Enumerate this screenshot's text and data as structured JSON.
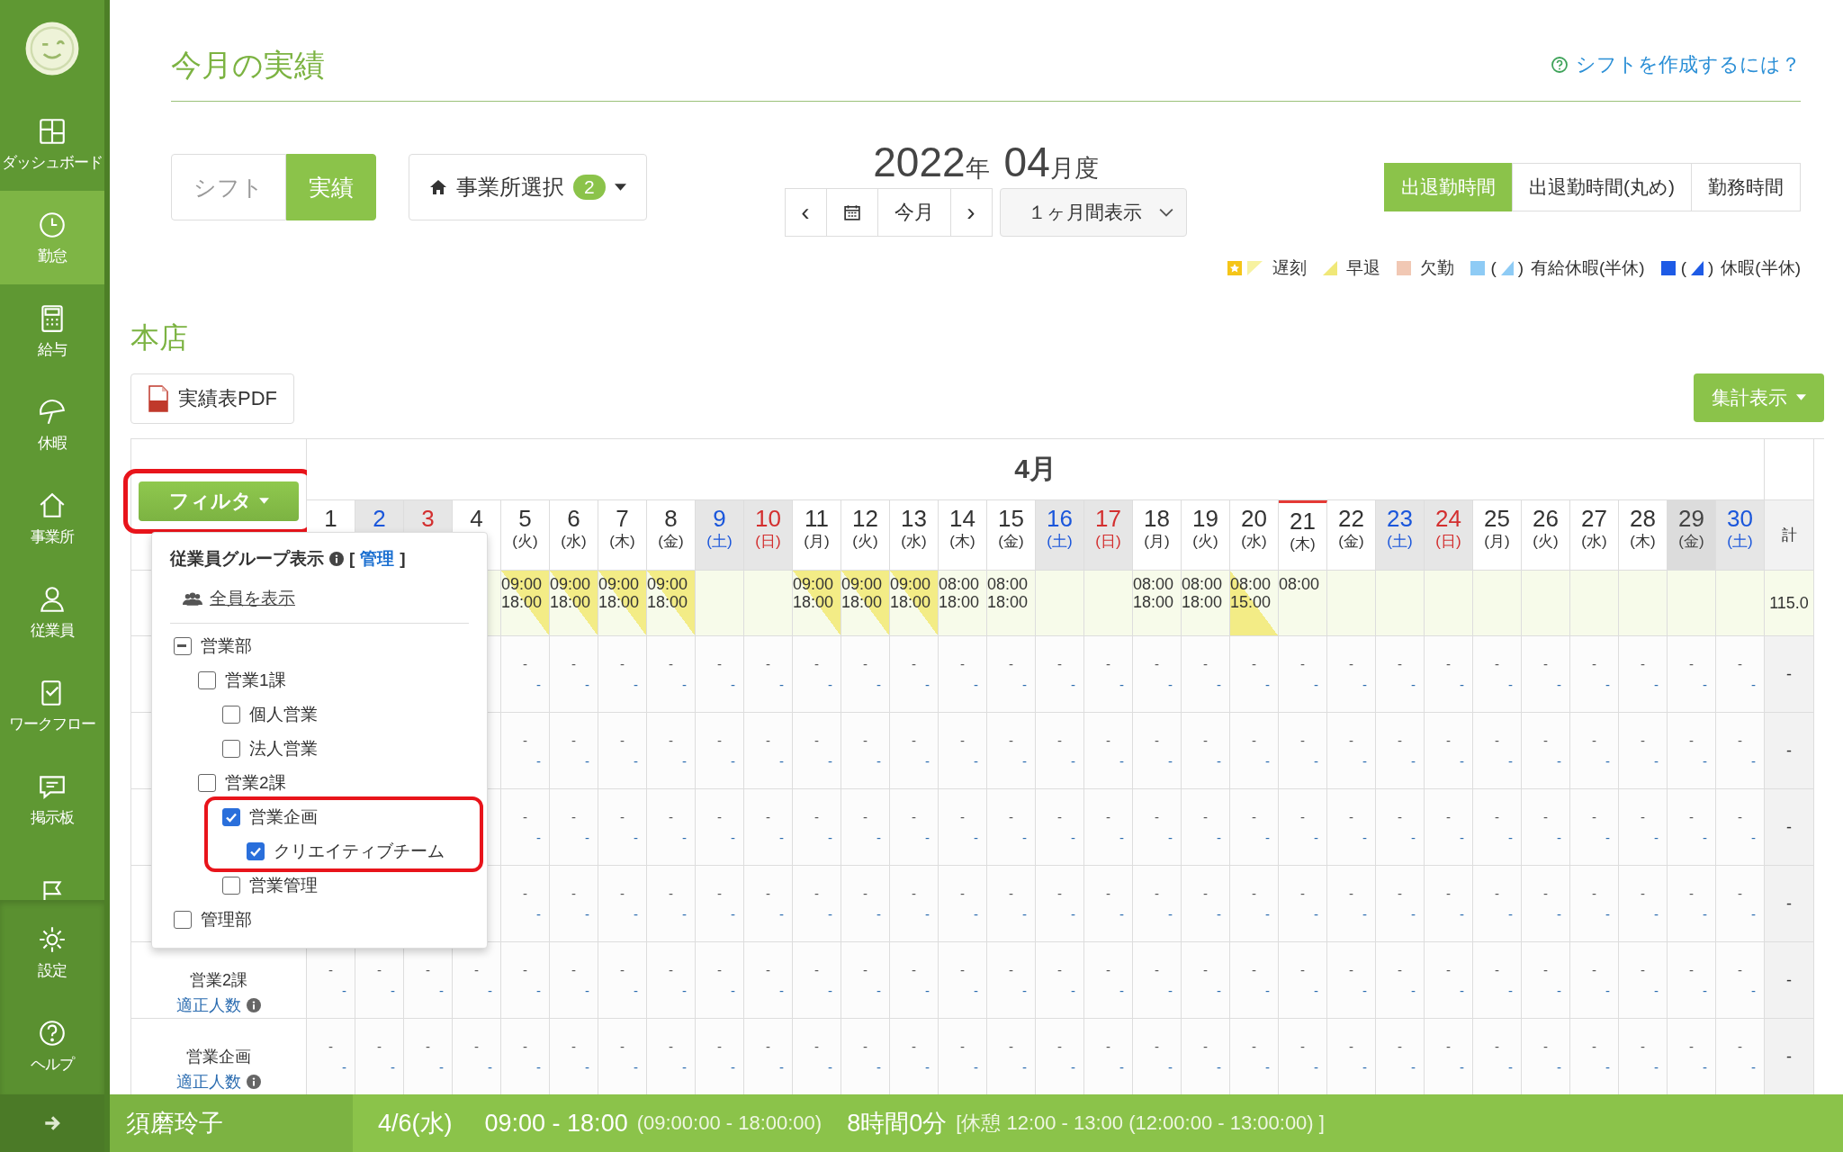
{
  "sidebar": {
    "items": [
      {
        "label": "ダッシュボード",
        "selected": false
      },
      {
        "label": "勤怠",
        "selected": true
      },
      {
        "label": "給与",
        "selected": false
      },
      {
        "label": "休暇",
        "selected": false
      },
      {
        "label": "事業所",
        "selected": false
      },
      {
        "label": "従業員",
        "selected": false
      },
      {
        "label": "ワークフロー",
        "selected": false
      },
      {
        "label": "掲示板",
        "selected": false
      },
      {
        "selected": false
      }
    ],
    "bottom_items": [
      {
        "label": "設定",
        "selected": false
      },
      {
        "label": "ヘルプ",
        "selected": false
      }
    ]
  },
  "header": {
    "title": "今月の実績",
    "help_link": "シフトを作成するには？"
  },
  "mode_tabs": [
    {
      "label": "シフト",
      "selected": false
    },
    {
      "label": "実績",
      "selected": true
    }
  ],
  "office_select": {
    "label": "事業所選択",
    "badge": "2"
  },
  "period": {
    "year": "2022",
    "year_unit": "年",
    "month": "04",
    "month_unit": "月度"
  },
  "nav": {
    "prev": "‹",
    "today": "今月",
    "next": "›",
    "range_select": "１ヶ月間表示"
  },
  "time_tabs": [
    {
      "label": "出退勤時間",
      "selected": true
    },
    {
      "label": "出退勤時間(丸め)",
      "selected": false
    },
    {
      "label": "勤務時間",
      "selected": false
    }
  ],
  "legend": [
    {
      "kind": "late",
      "label": "遅刻"
    },
    {
      "kind": "early",
      "label": "早退"
    },
    {
      "kind": "absent",
      "label": "欠勤"
    },
    {
      "kind": "paid",
      "label": "有給休暇(半休)",
      "paren_open": "(",
      "paren_close": ")"
    },
    {
      "kind": "leave",
      "label": "休暇(半休)",
      "paren_open": "(",
      "paren_close": ")"
    }
  ],
  "section": {
    "title": "本店",
    "pdf_button": "実績表PDF",
    "summary_button": "集計表示"
  },
  "filter": {
    "label": "フィルタ",
    "highlighted": true,
    "title": "従業員グループ表示",
    "manage_prefix": "[",
    "manage": "管理",
    "manage_suffix": "]",
    "show_all": "全員を表示",
    "groups": [
      {
        "label": "営業部",
        "checked": false,
        "indeterminate": true,
        "highlighted": false,
        "children": [
          {
            "label": "営業1課",
            "checked": false,
            "indeterminate": false,
            "highlighted": false,
            "children": [
              {
                "label": "個人営業",
                "checked": false,
                "indeterminate": false,
                "highlighted": false
              },
              {
                "label": "法人営業",
                "checked": false,
                "indeterminate": false,
                "highlighted": false
              }
            ]
          },
          {
            "label": "営業2課",
            "checked": false,
            "indeterminate": false,
            "highlighted": false,
            "children": [
              {
                "label": "営業企画",
                "checked": true,
                "indeterminate": false,
                "highlighted": true,
                "children": [
                  {
                    "label": "クリエイティブチーム",
                    "checked": true,
                    "indeterminate": false,
                    "highlighted": false
                  }
                ]
              },
              {
                "label": "営業管理",
                "checked": false,
                "indeterminate": false,
                "highlighted": false
              }
            ]
          }
        ]
      },
      {
        "label": "管理部",
        "checked": false,
        "indeterminate": false,
        "highlighted": false
      }
    ]
  },
  "table": {
    "month": "4月",
    "total_header": "計",
    "days": [
      {
        "num": "1",
        "kind": "weekday",
        "today": false
      },
      {
        "num": "2",
        "kind": "sat",
        "today": false
      },
      {
        "num": "3",
        "kind": "sun",
        "today": false
      },
      {
        "num": "4",
        "kind": "weekday",
        "today": false
      },
      {
        "num": "5",
        "dow": "(火)",
        "kind": "weekday",
        "today": false
      },
      {
        "num": "6",
        "dow": "(水)",
        "kind": "weekday",
        "today": false
      },
      {
        "num": "7",
        "dow": "(木)",
        "kind": "weekday",
        "today": false
      },
      {
        "num": "8",
        "dow": "(金)",
        "kind": "weekday",
        "today": false
      },
      {
        "num": "9",
        "dow": "(土)",
        "kind": "sat",
        "today": false
      },
      {
        "num": "10",
        "dow": "(日)",
        "kind": "sun",
        "today": false
      },
      {
        "num": "11",
        "dow": "(月)",
        "kind": "weekday",
        "today": false
      },
      {
        "num": "12",
        "dow": "(火)",
        "kind": "weekday",
        "today": false
      },
      {
        "num": "13",
        "dow": "(水)",
        "kind": "weekday",
        "today": false
      },
      {
        "num": "14",
        "dow": "(木)",
        "kind": "weekday",
        "today": false
      },
      {
        "num": "15",
        "dow": "(金)",
        "kind": "weekday",
        "today": false
      },
      {
        "num": "16",
        "dow": "(土)",
        "kind": "sat",
        "today": false
      },
      {
        "num": "17",
        "dow": "(日)",
        "kind": "sun",
        "today": false
      },
      {
        "num": "18",
        "dow": "(月)",
        "kind": "weekday",
        "today": false
      },
      {
        "num": "19",
        "dow": "(火)",
        "kind": "weekday",
        "today": false
      },
      {
        "num": "20",
        "dow": "(水)",
        "kind": "weekday",
        "today": false
      },
      {
        "num": "21",
        "dow": "(木)",
        "kind": "weekday",
        "today": true
      },
      {
        "num": "22",
        "dow": "(金)",
        "kind": "weekday",
        "today": false
      },
      {
        "num": "23",
        "dow": "(土)",
        "kind": "sat",
        "today": false
      },
      {
        "num": "24",
        "dow": "(日)",
        "kind": "sun",
        "today": false
      },
      {
        "num": "25",
        "dow": "(月)",
        "kind": "weekday",
        "today": false
      },
      {
        "num": "26",
        "dow": "(火)",
        "kind": "weekday",
        "today": false
      },
      {
        "num": "27",
        "dow": "(水)",
        "kind": "weekday",
        "today": false
      },
      {
        "num": "28",
        "dow": "(木)",
        "kind": "weekday",
        "today": false
      },
      {
        "num": "29",
        "dow": "(金)",
        "kind": "holiday",
        "today": false
      },
      {
        "num": "30",
        "dow": "(土)",
        "kind": "sat",
        "today": false
      }
    ],
    "rows": [
      {
        "kind": "shift",
        "total": "115.0",
        "cells": [
          {
            "in": "09:00",
            "out": "18:00",
            "kind": "late"
          },
          {
            "in": "09:00",
            "out": "18:00",
            "kind": "late"
          },
          {
            "in": "09:00",
            "out": "18:00",
            "kind": "late"
          },
          {
            "in": "09:00",
            "out": "18:00",
            "kind": "late"
          },
          {
            "kind": "empty"
          },
          {
            "kind": "empty"
          },
          {
            "in": "09:00",
            "out": "18:00",
            "kind": "late"
          },
          {
            "in": "09:00",
            "out": "18:00",
            "kind": "late"
          },
          {
            "in": "09:00",
            "out": "18:00",
            "kind": "late"
          },
          {
            "in": "08:00",
            "out": "18:00",
            "kind": "normal"
          },
          {
            "in": "08:00",
            "out": "18:00",
            "kind": "normal"
          },
          {
            "kind": "empty"
          },
          {
            "kind": "empty"
          },
          {
            "in": "08:00",
            "out": "18:00",
            "kind": "normal"
          },
          {
            "in": "08:00",
            "out": "18:00",
            "kind": "normal"
          },
          {
            "in": "08:00",
            "out": "15:00",
            "kind": "early"
          },
          {
            "in": "08:00",
            "kind": "normal"
          },
          {
            "kind": "empty"
          },
          {
            "kind": "empty"
          },
          {
            "kind": "empty"
          },
          {
            "kind": "empty"
          },
          {
            "kind": "empty"
          },
          {
            "kind": "empty"
          },
          {
            "kind": "empty"
          },
          {
            "kind": "empty"
          },
          {
            "kind": "empty"
          }
        ]
      },
      {
        "kind": "count",
        "total": "-",
        "counts": [
          "-",
          "-",
          "-",
          "-",
          "-",
          "-",
          "-",
          "-",
          "-",
          "-",
          "-",
          "-",
          "-",
          "-",
          "-",
          "-",
          "-",
          "-",
          "-",
          "-",
          "-",
          "-",
          "-",
          "-",
          "-",
          "-"
        ],
        "required": [
          "-",
          "-",
          "-",
          "-",
          "-",
          "-",
          "-",
          "-",
          "-",
          "-",
          "-",
          "-",
          "-",
          "-",
          "-",
          "-",
          "-",
          "-",
          "-",
          "-",
          "-",
          "-",
          "-",
          "-",
          "-",
          "-"
        ]
      },
      {
        "kind": "count",
        "total": "-",
        "counts": [
          "-",
          "-",
          "-",
          "-",
          "-",
          "-",
          "-",
          "-",
          "-",
          "-",
          "-",
          "-",
          "-",
          "-",
          "-",
          "-",
          "-",
          "-",
          "-",
          "-",
          "-",
          "-",
          "-",
          "-",
          "-",
          "-"
        ],
        "required": [
          "-",
          "-",
          "-",
          "-",
          "-",
          "-",
          "-",
          "-",
          "-",
          "-",
          "-",
          "-",
          "-",
          "-",
          "-",
          "-",
          "-",
          "-",
          "-",
          "-",
          "-",
          "-",
          "-",
          "-",
          "-",
          "-"
        ]
      },
      {
        "kind": "count",
        "total": "-",
        "counts": [
          "-",
          "-",
          "-",
          "-",
          "-",
          "-",
          "-",
          "-",
          "-",
          "-",
          "-",
          "-",
          "-",
          "-",
          "-",
          "-",
          "-",
          "-",
          "-",
          "-",
          "-",
          "-",
          "-",
          "-",
          "-",
          "-"
        ],
        "required": [
          "-",
          "-",
          "-",
          "-",
          "-",
          "-",
          "-",
          "-",
          "-",
          "-",
          "-",
          "-",
          "-",
          "-",
          "-",
          "-",
          "-",
          "-",
          "-",
          "-",
          "-",
          "-",
          "-",
          "-",
          "-",
          "-"
        ]
      },
      {
        "kind": "count",
        "total": "-",
        "counts": [
          "-",
          "-",
          "-",
          "-",
          "-",
          "-",
          "-",
          "-",
          "-",
          "-",
          "-",
          "-",
          "-",
          "-",
          "-",
          "-",
          "-",
          "-",
          "-",
          "-",
          "-",
          "-",
          "-",
          "-",
          "-",
          "-"
        ],
        "required": [
          "-",
          "-",
          "-",
          "-",
          "-",
          "-",
          "-",
          "-",
          "-",
          "-",
          "-",
          "-",
          "-",
          "-",
          "-",
          "-",
          "-",
          "-",
          "-",
          "-",
          "-",
          "-",
          "-",
          "-",
          "-",
          "-"
        ]
      },
      {
        "kind": "count",
        "label": "営業2課",
        "required_link": "適正人数",
        "total": "-",
        "counts": [
          "-",
          "-",
          "-",
          "-",
          "-",
          "-",
          "-",
          "-",
          "-",
          "-",
          "-",
          "-",
          "-",
          "-",
          "-",
          "-",
          "-",
          "-",
          "-",
          "-",
          "-",
          "-",
          "-",
          "-",
          "-",
          "-",
          "-",
          "-",
          "-",
          "-"
        ],
        "required": [
          "-",
          "-",
          "-",
          "-",
          "-",
          "-",
          "-",
          "-",
          "-",
          "-",
          "-",
          "-",
          "-",
          "-",
          "-",
          "-",
          "-",
          "-",
          "-",
          "-",
          "-",
          "-",
          "-",
          "-",
          "-",
          "-",
          "-",
          "-",
          "-",
          "-"
        ]
      },
      {
        "kind": "count",
        "label": "営業企画",
        "required_link": "適正人数",
        "total": "-",
        "counts": [
          "-",
          "-",
          "-",
          "-",
          "-",
          "-",
          "-",
          "-",
          "-",
          "-",
          "-",
          "-",
          "-",
          "-",
          "-",
          "-",
          "-",
          "-",
          "-",
          "-",
          "-",
          "-",
          "-",
          "-",
          "-",
          "-",
          "-",
          "-",
          "-",
          "-"
        ],
        "required": [
          "-",
          "-",
          "-",
          "-",
          "-",
          "-",
          "-",
          "-",
          "-",
          "-",
          "-",
          "-",
          "-",
          "-",
          "-",
          "-",
          "-",
          "-",
          "-",
          "-",
          "-",
          "-",
          "-",
          "-",
          "-",
          "-",
          "-",
          "-",
          "-",
          "-"
        ]
      }
    ]
  },
  "footer": {
    "name": "須磨玲子",
    "date": "4/6(水)",
    "time": "09:00 - 18:00",
    "time_exact": "(09:00:00 - 18:00:00)",
    "duration": "8時間0分",
    "break": "[休憩 12:00 - 13:00 (12:00:00 - 13:00:00) ]"
  }
}
